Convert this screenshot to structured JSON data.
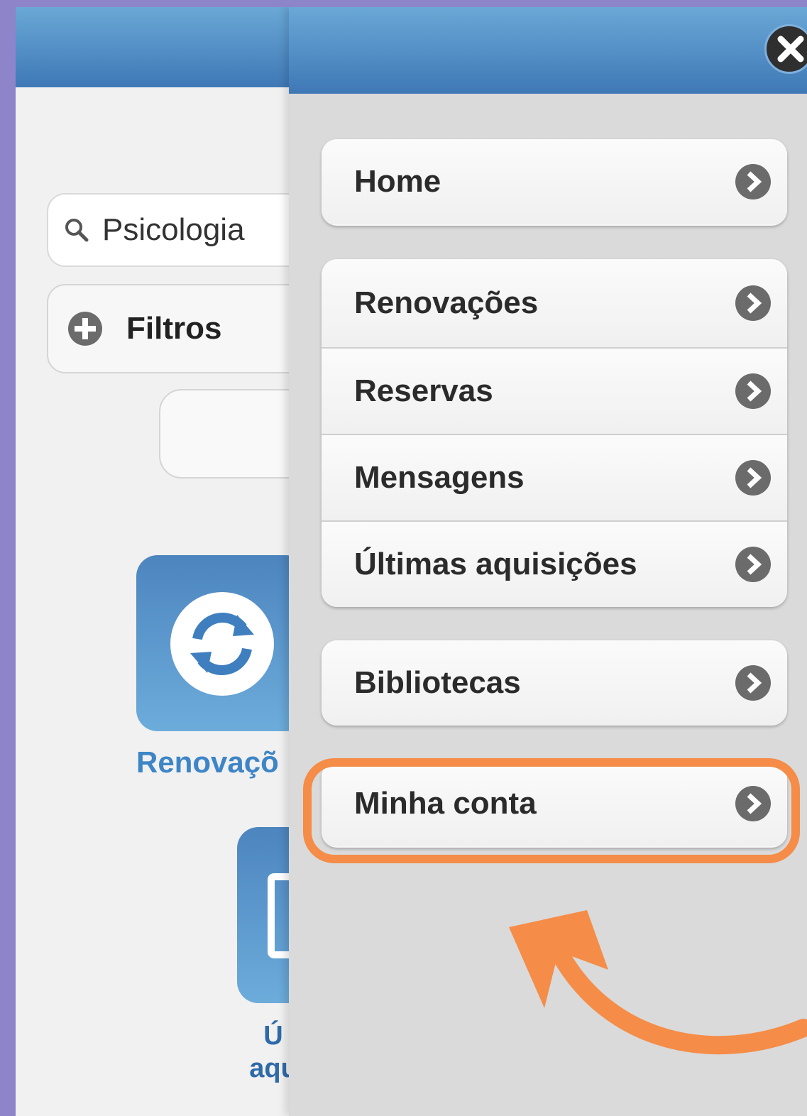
{
  "search": {
    "value": "Psicologia"
  },
  "filters": {
    "label": "Filtros"
  },
  "tiles": {
    "renew_label": "Renovaçõ",
    "acquisitions_label_line1": "Ú",
    "acquisitions_label_line2": "aqu"
  },
  "menu": {
    "groups": [
      {
        "items": [
          {
            "label": "Home"
          }
        ]
      },
      {
        "items": [
          {
            "label": "Renovações"
          },
          {
            "label": "Reservas"
          },
          {
            "label": "Mensagens"
          },
          {
            "label": "Últimas aquisições"
          }
        ]
      },
      {
        "items": [
          {
            "label": "Bibliotecas"
          }
        ]
      },
      {
        "items": [
          {
            "label": "Minha conta"
          }
        ]
      }
    ]
  },
  "colors": {
    "header_blue": "#4a86c2",
    "accent_orange": "#f58c47",
    "frame_purple": "#8e84c9"
  },
  "icons": {
    "close": "close-icon",
    "search": "search-icon",
    "filters": "plus-circle-icon",
    "menu_arrow": "chevron-right-circle-icon",
    "renew": "refresh-icon",
    "acquisitions": "document-icon"
  }
}
